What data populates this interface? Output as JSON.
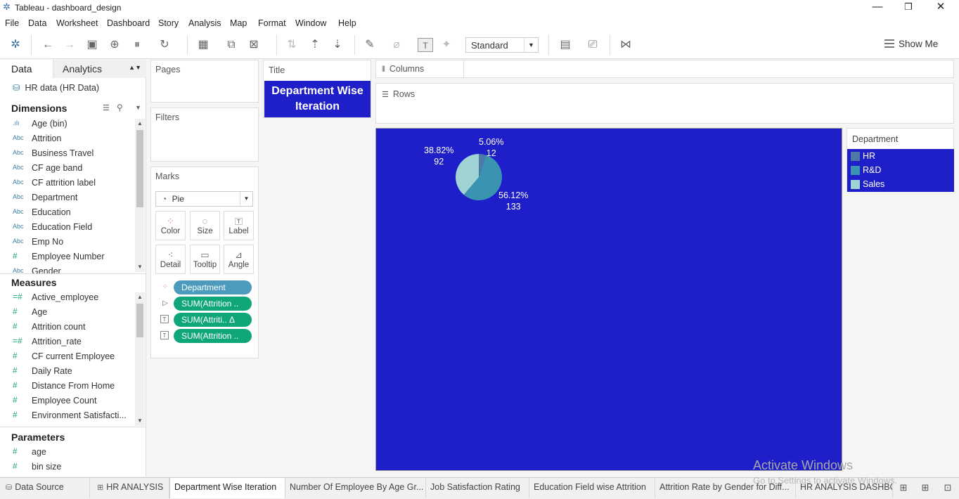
{
  "window": {
    "title": "Tableau - dashboard_design",
    "minimize": "—",
    "restore": "❐",
    "close": "✕"
  },
  "menu": [
    "File",
    "Data",
    "Worksheet",
    "Dashboard",
    "Story",
    "Analysis",
    "Map",
    "Format",
    "Window",
    "Help"
  ],
  "toolbar": {
    "fit_mode": "Standard",
    "show_me": "Show Me"
  },
  "data_pane": {
    "tabs": {
      "data": "Data",
      "analytics": "Analytics"
    },
    "datasource": "HR data (HR Data)",
    "dimensions_header": "Dimensions",
    "dimensions": [
      {
        "icon": ".ılı",
        "label": "Age (bin)"
      },
      {
        "icon": "Abc",
        "label": "Attrition"
      },
      {
        "icon": "Abc",
        "label": "Business Travel"
      },
      {
        "icon": "Abc",
        "label": "CF age band"
      },
      {
        "icon": "Abc",
        "label": "CF attrition label"
      },
      {
        "icon": "Abc",
        "label": "Department"
      },
      {
        "icon": "Abc",
        "label": "Education"
      },
      {
        "icon": "Abc",
        "label": "Education Field"
      },
      {
        "icon": "Abc",
        "label": "Emp No"
      },
      {
        "icon": "#",
        "label": "Employee Number"
      },
      {
        "icon": "Abc",
        "label": "Gender"
      }
    ],
    "measures_header": "Measures",
    "measures": [
      {
        "icon": "=#",
        "label": "Active_employee"
      },
      {
        "icon": "#",
        "label": "Age"
      },
      {
        "icon": "#",
        "label": "Attrition count"
      },
      {
        "icon": "=#",
        "label": "Attrition_rate"
      },
      {
        "icon": "#",
        "label": "CF current Employee"
      },
      {
        "icon": "#",
        "label": "Daily Rate"
      },
      {
        "icon": "#",
        "label": "Distance From Home"
      },
      {
        "icon": "#",
        "label": "Employee Count"
      },
      {
        "icon": "#",
        "label": "Environment Satisfacti..."
      }
    ],
    "parameters_header": "Parameters",
    "parameters": [
      {
        "icon": "#",
        "label": "age"
      },
      {
        "icon": "#",
        "label": "bin size"
      }
    ]
  },
  "shelves": {
    "pages": "Pages",
    "filters": "Filters",
    "marks": "Marks",
    "mark_type": "Pie",
    "mark_buttons": [
      "Color",
      "Size",
      "Label",
      "Detail",
      "Tooltip",
      "Angle"
    ],
    "pills": [
      "Department",
      "SUM(Attrition ..",
      "SUM(Attriti..  Δ",
      "SUM(Attrition .."
    ],
    "columns": "Columns",
    "rows": "Rows",
    "title_card": "Title"
  },
  "viz": {
    "title": "Department Wise Iteration",
    "background": "#1f1fc9",
    "slice_labels": [
      {
        "pct": "5.06%",
        "count": "12"
      },
      {
        "pct": "56.12%",
        "count": "133"
      },
      {
        "pct": "38.82%",
        "count": "92"
      }
    ]
  },
  "legend": {
    "title": "Department",
    "items": [
      {
        "label": "HR",
        "color": "#4e79a7"
      },
      {
        "label": "R&D",
        "color": "#3a93b0"
      },
      {
        "label": "Sales",
        "color": "#a0d4d4"
      }
    ]
  },
  "chart_data": {
    "type": "pie",
    "title": "Department Wise Iteration",
    "categories": [
      "HR",
      "R&D",
      "Sales"
    ],
    "values": [
      12,
      133,
      92
    ],
    "percentages": [
      5.06,
      56.12,
      38.82
    ],
    "colors": [
      "#4e79a7",
      "#3a93b0",
      "#a0d4d4"
    ]
  },
  "watermark": {
    "line1": "Activate Windows",
    "line2": "Go to Settings to activate Windows."
  },
  "sheet_tabs": [
    "Data Source",
    "HR ANALYSIS",
    "Department Wise Iteration",
    "Number Of Employee By Age Gr...",
    "Job Satisfaction Rating",
    "Education Field wise Attrition",
    "Attrition Rate by Gender for Diff...",
    "HR ANALYSIS DASHBOARD"
  ]
}
